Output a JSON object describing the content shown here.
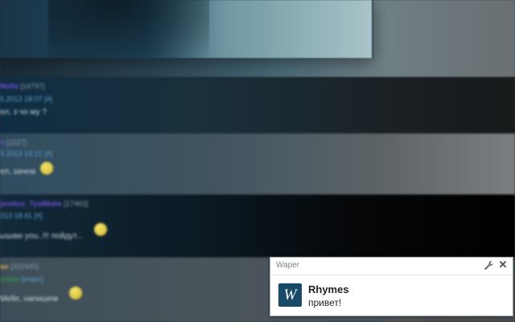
{
  "background": {
    "posts": [
      {
        "author": "Mello",
        "count": "[14797]",
        "date": "5.2013 18:07",
        "reply": "[#]",
        "text": "ел, з чо му ?"
      },
      {
        "author": "h",
        "count": "[1527]",
        "date": "5.2013 19:21",
        "reply": "[#]",
        "text": "ел, зачем"
      },
      {
        "author": "jerekus_TyaiMatie",
        "count": "[17463]",
        "date": "013 18:41",
        "reply": "[#]",
        "text": "ышаю you..!!! пойдут..."
      },
      {
        "author": "ан",
        "count": "[332945]",
        "date": "",
        "status": "online",
        "reply": "[ответ]",
        "text": "Melle, напишем"
      }
    ]
  },
  "notification": {
    "app_name": "Waper",
    "icon_letter": "W",
    "title": "Rhymes",
    "body": "привет!",
    "close_symbol": "✕",
    "colors": {
      "icon_bg": "#184a67",
      "border": "#9aa0a4"
    }
  }
}
